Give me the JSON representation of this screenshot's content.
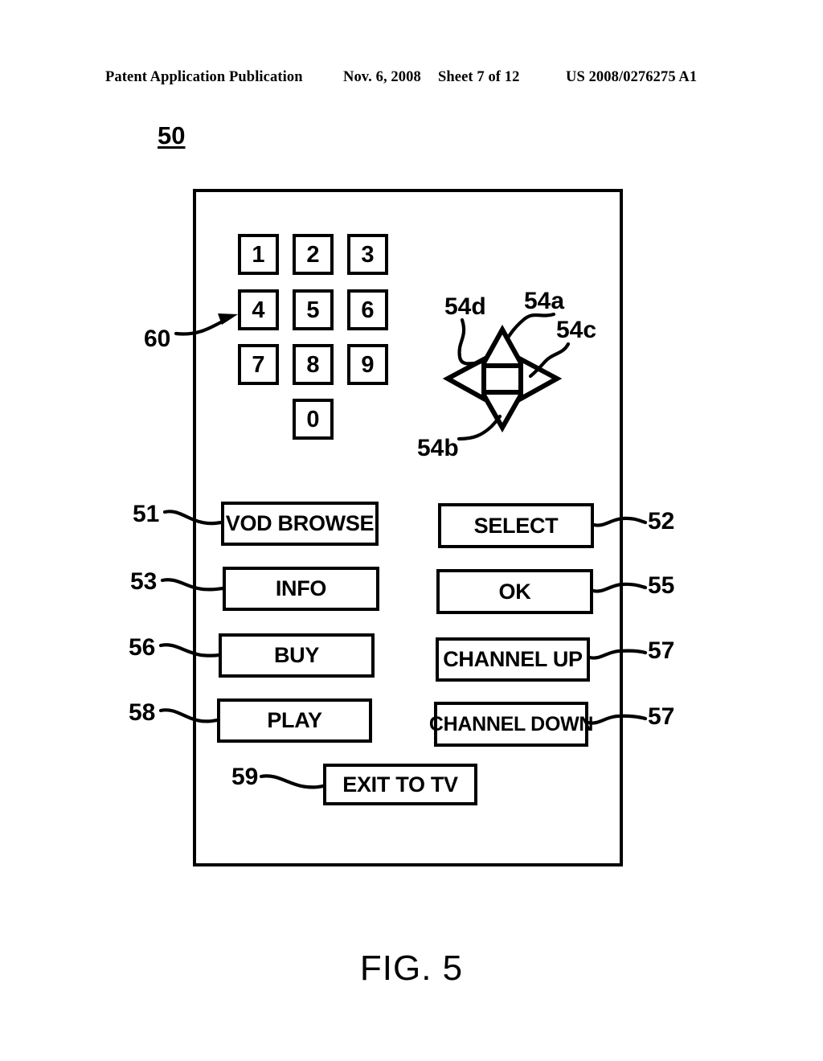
{
  "header": {
    "publication": "Patent Application Publication",
    "date": "Nov. 6, 2008",
    "sheet": "Sheet 7 of 12",
    "patent_number": "US 2008/0276275 A1"
  },
  "figure": {
    "caption": "FIG. 5",
    "device_ref": "50"
  },
  "keypad": {
    "ref": "60",
    "keys": [
      {
        "label": "1"
      },
      {
        "label": "2"
      },
      {
        "label": "3"
      },
      {
        "label": "4"
      },
      {
        "label": "5"
      },
      {
        "label": "6"
      },
      {
        "label": "7"
      },
      {
        "label": "8"
      },
      {
        "label": "9"
      },
      {
        "label": "0"
      }
    ]
  },
  "dpad": {
    "up": {
      "ref": "54a",
      "name": "up-arrow"
    },
    "down": {
      "ref": "54b",
      "name": "down-arrow"
    },
    "right": {
      "ref": "54c",
      "name": "right-arrow"
    },
    "left": {
      "ref": "54d",
      "name": "left-arrow"
    }
  },
  "buttons": {
    "vod_browse": {
      "label": "VOD BROWSE",
      "ref": "51"
    },
    "select": {
      "label": "SELECT",
      "ref": "52"
    },
    "info": {
      "label": "INFO",
      "ref": "53"
    },
    "ok": {
      "label": "OK",
      "ref": "55"
    },
    "buy": {
      "label": "BUY",
      "ref": "56"
    },
    "channel_up": {
      "label": "CHANNEL UP",
      "ref": "57"
    },
    "play": {
      "label": "PLAY",
      "ref": "58"
    },
    "channel_down": {
      "label": "CHANNEL DOWN",
      "ref": "57"
    },
    "exit_to_tv": {
      "label": "EXIT TO TV",
      "ref": "59"
    }
  },
  "colors": {
    "ink": "#000000",
    "paper": "#ffffff"
  }
}
